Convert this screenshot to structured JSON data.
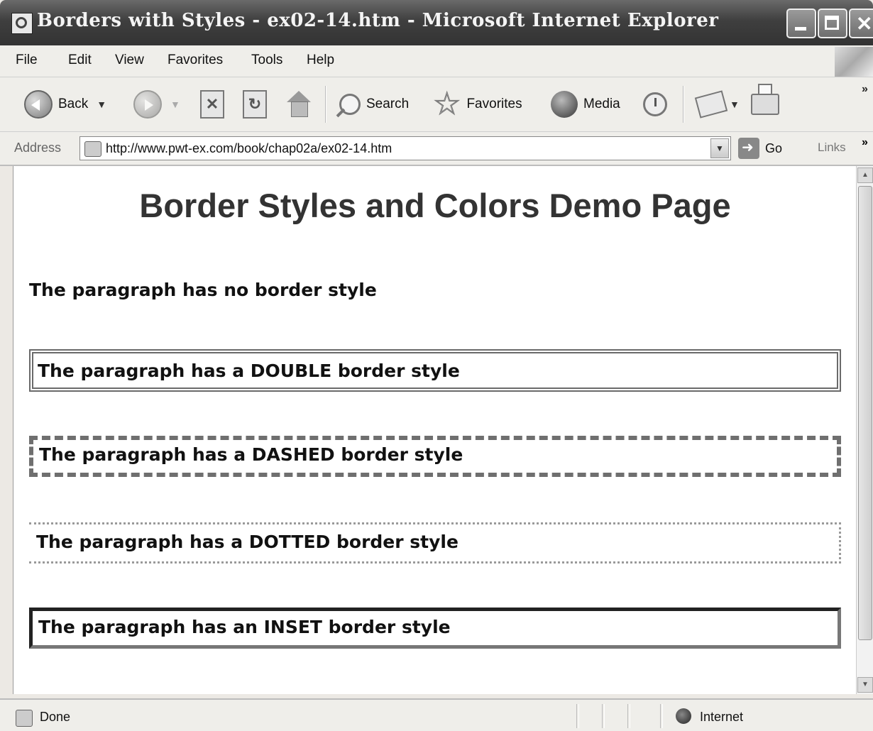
{
  "window": {
    "title": "Borders with Styles - ex02-14.htm - Microsoft Internet Explorer"
  },
  "menu": {
    "file": "File",
    "edit": "Edit",
    "view": "View",
    "favorites": "Favorites",
    "tools": "Tools",
    "help": "Help"
  },
  "toolbar": {
    "back": "Back",
    "search": "Search",
    "favorites": "Favorites",
    "media": "Media"
  },
  "address": {
    "label": "Address",
    "url": "http://www.pwt-ex.com/book/chap02a/ex02-14.htm",
    "go": "Go",
    "links": "Links"
  },
  "page": {
    "heading": "Border Styles and Colors Demo Page",
    "paragraphs": {
      "none": "The paragraph has no border style",
      "double": "The paragraph has a DOUBLE border style",
      "dashed": "The paragraph has a DASHED border style",
      "dotted": "The paragraph has a DOTTED border style",
      "inset": "The paragraph has an INSET border style"
    }
  },
  "status": {
    "text": "Done",
    "zone": "Internet"
  },
  "icons": [
    "ie-page-icon",
    "minimize-icon",
    "maximize-icon",
    "close-icon",
    "windows-logo-icon",
    "back-icon",
    "forward-icon",
    "stop-icon",
    "refresh-icon",
    "home-icon",
    "search-icon",
    "favorites-star-icon",
    "media-icon",
    "history-icon",
    "mail-icon",
    "print-icon",
    "go-arrow-icon",
    "globe-icon"
  ]
}
